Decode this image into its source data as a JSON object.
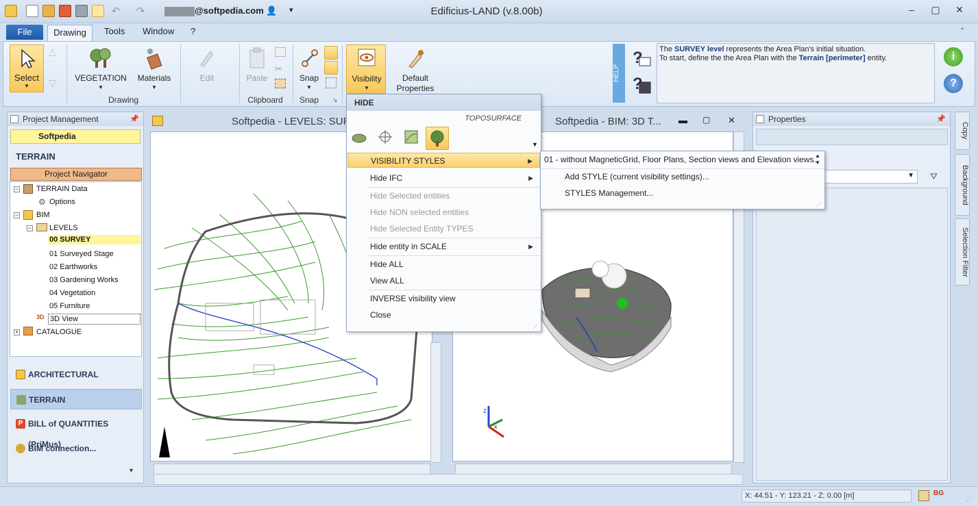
{
  "app": {
    "title": "Edificius-LAND (v.8.00b)",
    "account": "@softpedia.com",
    "window_controls": [
      "minimize-icon",
      "maximize-icon",
      "close-icon"
    ]
  },
  "tabs": {
    "file": "File",
    "items": [
      "Drawing",
      "Tools",
      "Window",
      "?"
    ],
    "active": "Drawing"
  },
  "ribbon": {
    "select": "Select",
    "vegetation": "VEGETATION",
    "materials": "Materials",
    "edit": "Edit",
    "drawing_group": "Drawing",
    "paste": "Paste",
    "clipboard_group": "Clipboard",
    "snap": "Snap",
    "snap_group": "Snap",
    "visibility": "Visibility",
    "default_line1": "Default",
    "default_line2": "Properties",
    "help_tab": "HELP",
    "help_p1_pre": "The ",
    "help_p1_b": "SURVEY level",
    "help_p1_post": " represents the Area Plan's initial situation.",
    "help_p2_pre": "To start, define the the Area Plan with the ",
    "help_p2_b": "Terrain [perimeter]",
    "help_p2_post": " entity."
  },
  "left_panel": {
    "header": "Project Management",
    "project": "Softpedia",
    "section": "TERRAIN",
    "navigator": "Project Navigator",
    "tree": {
      "terrain_data": "TERRAIN Data",
      "options": "Options",
      "bim": "BIM",
      "levels": "LEVELS",
      "level_items": [
        "00 SURVEY",
        "01 Surveyed Stage",
        "02 Earthworks",
        "03 Gardening Works",
        "04 Vegetation",
        "05 Furniture"
      ],
      "view3d": "3D View",
      "catalogue": "CATALOGUE"
    },
    "modules": [
      "ARCHITECTURAL",
      "TERRAIN",
      "BILL of QUANTITIES (PriMus)",
      "BIM connection..."
    ]
  },
  "views": {
    "left_title": "Softpedia -  LEVELS: SURV",
    "right_title": "Softpedia -  BIM: 3D T..."
  },
  "properties": {
    "header": "Properties"
  },
  "side_tabs": [
    "Copy",
    "Background",
    "Selection Filter"
  ],
  "menu": {
    "header": "HIDE",
    "toposurface": "TOPOSURFACE",
    "items": [
      {
        "label": "VISIBILITY STYLES",
        "state": "highlighted",
        "submenu": true
      },
      {
        "label": "Hide IFC",
        "state": "enabled",
        "submenu": true
      },
      {
        "label": "Hide Selected entities",
        "state": "disabled"
      },
      {
        "label": "Hide NON selected entities",
        "state": "disabled"
      },
      {
        "label": "Hide Selected Entity TYPES",
        "state": "disabled"
      },
      {
        "label": "Hide entity in SCALE",
        "state": "enabled",
        "submenu": true
      },
      {
        "label": "Hide ALL",
        "state": "enabled"
      },
      {
        "label": "View ALL",
        "state": "enabled"
      },
      {
        "label": "INVERSE visibility view",
        "state": "enabled"
      },
      {
        "label": "Close",
        "state": "enabled"
      }
    ]
  },
  "submenu": {
    "items": [
      "01 - without MagneticGrid, Floor Plans, Section views and Elevation views.",
      "Add STYLE (current visibility settings)...",
      "STYLES Management..."
    ]
  },
  "status": {
    "coords": "X: 44.51 - Y: 123.21 - Z: 0.00 [m]"
  },
  "colors": {
    "highlight": "#f8cf6d",
    "contour_green": "#3a9a2a",
    "selected_level": "#fff59a",
    "file_tab": "#1f5aa8"
  }
}
